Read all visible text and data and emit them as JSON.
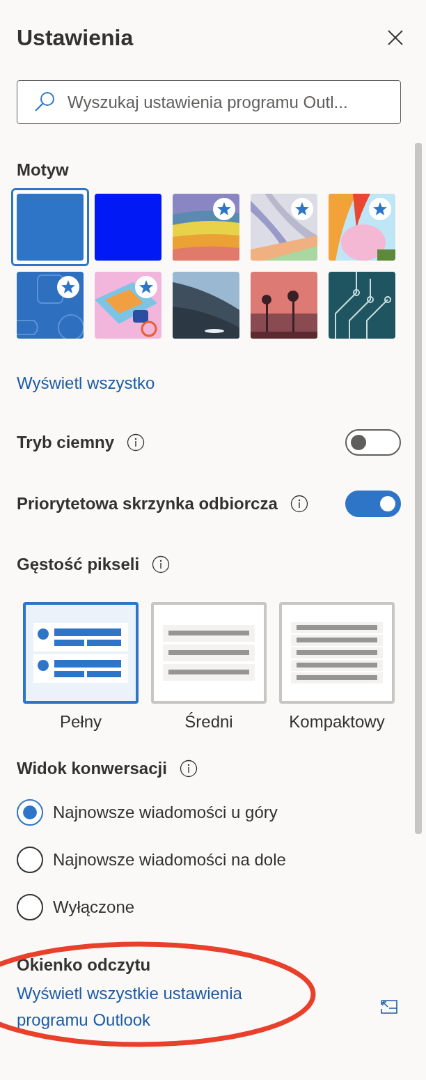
{
  "title": "Ustawienia",
  "search": {
    "placeholder": "Wyszukaj ustawienia programu Outl..."
  },
  "theme": {
    "heading": "Motyw",
    "tiles": [
      {
        "kind": "color",
        "color": "#2e75c8",
        "selected": true
      },
      {
        "kind": "color",
        "color": "#0019f5",
        "selected": false
      },
      {
        "kind": "picture",
        "premium": true,
        "selected": false
      },
      {
        "kind": "picture",
        "premium": true,
        "selected": false
      },
      {
        "kind": "picture",
        "premium": true,
        "selected": false
      },
      {
        "kind": "picture",
        "premium": true,
        "selected": false
      },
      {
        "kind": "picture",
        "premium": true,
        "selected": false
      },
      {
        "kind": "picture",
        "selected": false
      },
      {
        "kind": "picture",
        "selected": false
      },
      {
        "kind": "picture",
        "selected": false
      }
    ],
    "link": "Wyświetl wszystko"
  },
  "toggles": [
    {
      "label": "Tryb ciemny",
      "on": false
    },
    {
      "label": "Priorytetowa skrzynka odbiorcza",
      "on": true
    }
  ],
  "density": {
    "heading": "Gęstość pikseli",
    "options": [
      {
        "label": "Pełny",
        "selected": true
      },
      {
        "label": "Średni",
        "selected": false
      },
      {
        "label": "Kompaktowy",
        "selected": false
      }
    ]
  },
  "conversation": {
    "heading": "Widok konwersacji",
    "options": [
      {
        "label": "Najnowsze wiadomości u góry",
        "selected": true
      },
      {
        "label": "Najnowsze wiadomości na dole",
        "selected": false
      },
      {
        "label": "Wyłączone",
        "selected": false
      }
    ]
  },
  "reading_pane": {
    "heading": "Okienko odczytu"
  },
  "footer_link": "Wyświetl wszystkie ustawienia programu Outlook"
}
